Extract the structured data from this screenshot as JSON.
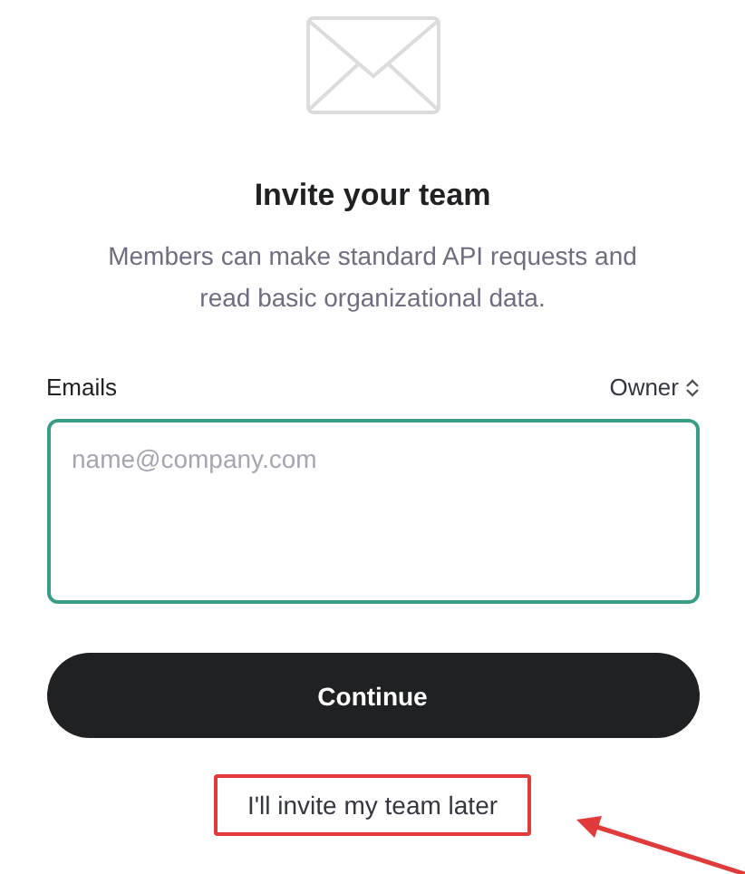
{
  "title": "Invite your team",
  "description": "Members can make standard API requests and read basic organizational data.",
  "emails": {
    "label": "Emails",
    "role": "Owner",
    "placeholder": "name@company.com"
  },
  "continue_button": "Continue",
  "later_link": {
    "label": "I'll invite my team later",
    "highlighted": true
  }
}
